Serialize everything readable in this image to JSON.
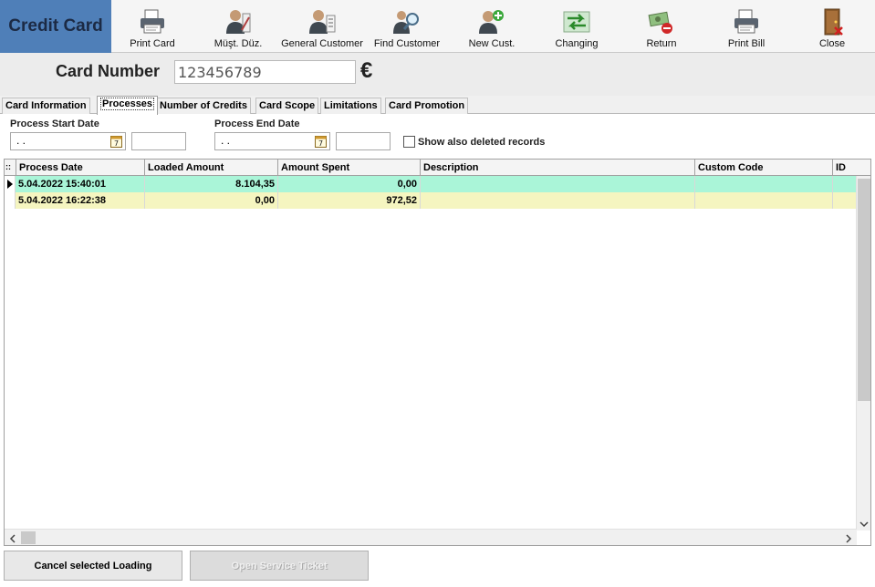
{
  "window": {
    "title": "Credit Card"
  },
  "toolbar": {
    "buttons": [
      {
        "id": "print-card",
        "label": "Print Card",
        "icon": "printer-icon"
      },
      {
        "id": "must-duz",
        "label": "Müşt. Düz.",
        "icon": "user-edit-icon"
      },
      {
        "id": "general-customer",
        "label": "General Customer",
        "icon": "user-list-icon"
      },
      {
        "id": "find-customer",
        "label": "Find Customer",
        "icon": "user-search-icon"
      },
      {
        "id": "new-cust",
        "label": "New Cust.",
        "icon": "user-add-icon"
      },
      {
        "id": "changing",
        "label": "Changing",
        "icon": "exchange-icon"
      },
      {
        "id": "return",
        "label": "Return",
        "icon": "money-return-icon"
      },
      {
        "id": "print-bill",
        "label": "Print Bill",
        "icon": "printer-icon"
      },
      {
        "id": "close",
        "label": "Close",
        "icon": "door-close-icon"
      }
    ]
  },
  "card": {
    "label": "Card Number",
    "value": "123456789",
    "currency_symbol": "€"
  },
  "tabs": [
    {
      "label": "Card Information",
      "active": false
    },
    {
      "label": "Processes",
      "active": true
    },
    {
      "label": "Number of Credits",
      "active": false
    },
    {
      "label": "Card Scope",
      "active": false
    },
    {
      "label": "Limitations",
      "active": false
    },
    {
      "label": "Card Promotion",
      "active": false
    }
  ],
  "filters": {
    "start_label": "Process Start Date",
    "start_value": ". .",
    "end_label": "Process End Date",
    "end_value": ". .",
    "calendar_glyph": "7",
    "show_deleted_label": "Show also deleted records",
    "show_deleted_checked": false
  },
  "grid": {
    "indicator_glyph": "::",
    "columns": [
      "Process Date",
      "Loaded Amount",
      "Amount Spent",
      "Description",
      "Custom Code",
      "ID"
    ],
    "rows": [
      {
        "date": "5.04.2022 15:40:01",
        "loaded": "8.104,35",
        "spent": "0,00",
        "description": "",
        "custom_code": "",
        "id": "",
        "color": "#aaf5d8",
        "selected": true
      },
      {
        "date": "5.04.2022 16:22:38",
        "loaded": "0,00",
        "spent": "972,52",
        "description": "",
        "custom_code": "",
        "id": "",
        "color": "#f5f5c0",
        "selected": false
      }
    ]
  },
  "footer": {
    "cancel_label": "Cancel selected Loading",
    "service_label": "Open Service Ticket"
  },
  "colors": {
    "title_bg": "#4f7fb8",
    "row_loaded": "#aaf5d8",
    "row_spent": "#f5f5c0"
  }
}
